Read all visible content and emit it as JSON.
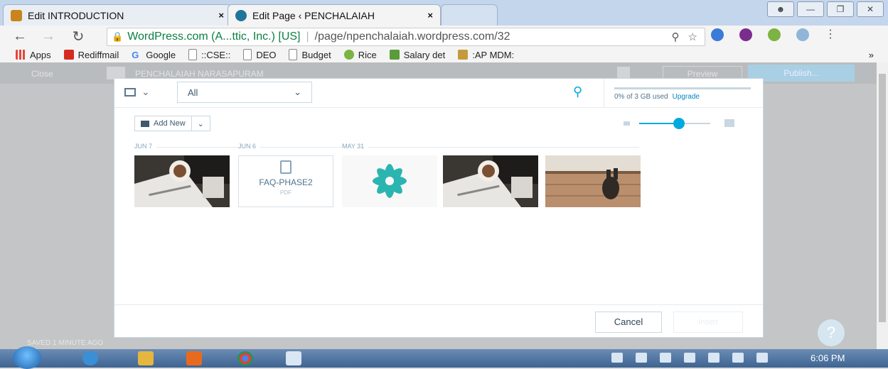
{
  "browser": {
    "tabs": [
      {
        "title": "Edit INTRODUCTION",
        "close": "×",
        "favicon": "m-icon"
      },
      {
        "title": "Edit Page ‹ PENCHALAIAH",
        "close": "×",
        "favicon": "wordpress-icon"
      }
    ],
    "url": {
      "security_label": "WordPress.com (A...ttic, Inc.) [US]",
      "path": "/page/npenchalaiah.wordpress.com/32"
    },
    "bookmarks": [
      {
        "label": "Apps",
        "color": "#e8453c"
      },
      {
        "label": "Rediffmail",
        "color": "#d52b1e"
      },
      {
        "label": "Google",
        "color": "#4285f4"
      },
      {
        "label": "::CSE::",
        "color": "#888888"
      },
      {
        "label": "DEO",
        "color": "#888888"
      },
      {
        "label": "Budget",
        "color": "#888888"
      },
      {
        "label": "Rice",
        "color": "#7cb342"
      },
      {
        "label": "Salary det",
        "color": "#5a9b3a"
      },
      {
        "label": ":AP MDM:",
        "color": "#c49a3c"
      }
    ],
    "bookmarks_more": "»"
  },
  "editor": {
    "close_label": "Close",
    "site_label": "PENCHALAIAH NARASAPURAM",
    "preview_label": "Preview",
    "publish_label": "Publish...",
    "saved_label": "SAVED 1 MINUTE AGO"
  },
  "media_modal": {
    "filter_value": "All",
    "storage_text": "0% of 3 GB used",
    "storage_used_percent": 0,
    "upgrade_label": "Upgrade",
    "add_new_label": "Add New",
    "zoom_level": 0.56,
    "dates": [
      "JUN 7",
      "JUN 6",
      "MAY 31"
    ],
    "items": [
      {
        "type": "image",
        "icon": "coffee-desk-photo"
      },
      {
        "type": "document",
        "name": "FAQ-PHASE2",
        "ext": "PDF"
      },
      {
        "type": "image",
        "icon": "teal-flower-logo"
      },
      {
        "type": "image",
        "icon": "coffee-desk-photo"
      },
      {
        "type": "image",
        "icon": "table-phone-photo"
      }
    ],
    "cancel_label": "Cancel",
    "insert_label": "Insert"
  },
  "taskbar": {
    "time": "6:06 PM"
  },
  "colors": {
    "accent": "#00aadc",
    "link": "#0087be"
  }
}
